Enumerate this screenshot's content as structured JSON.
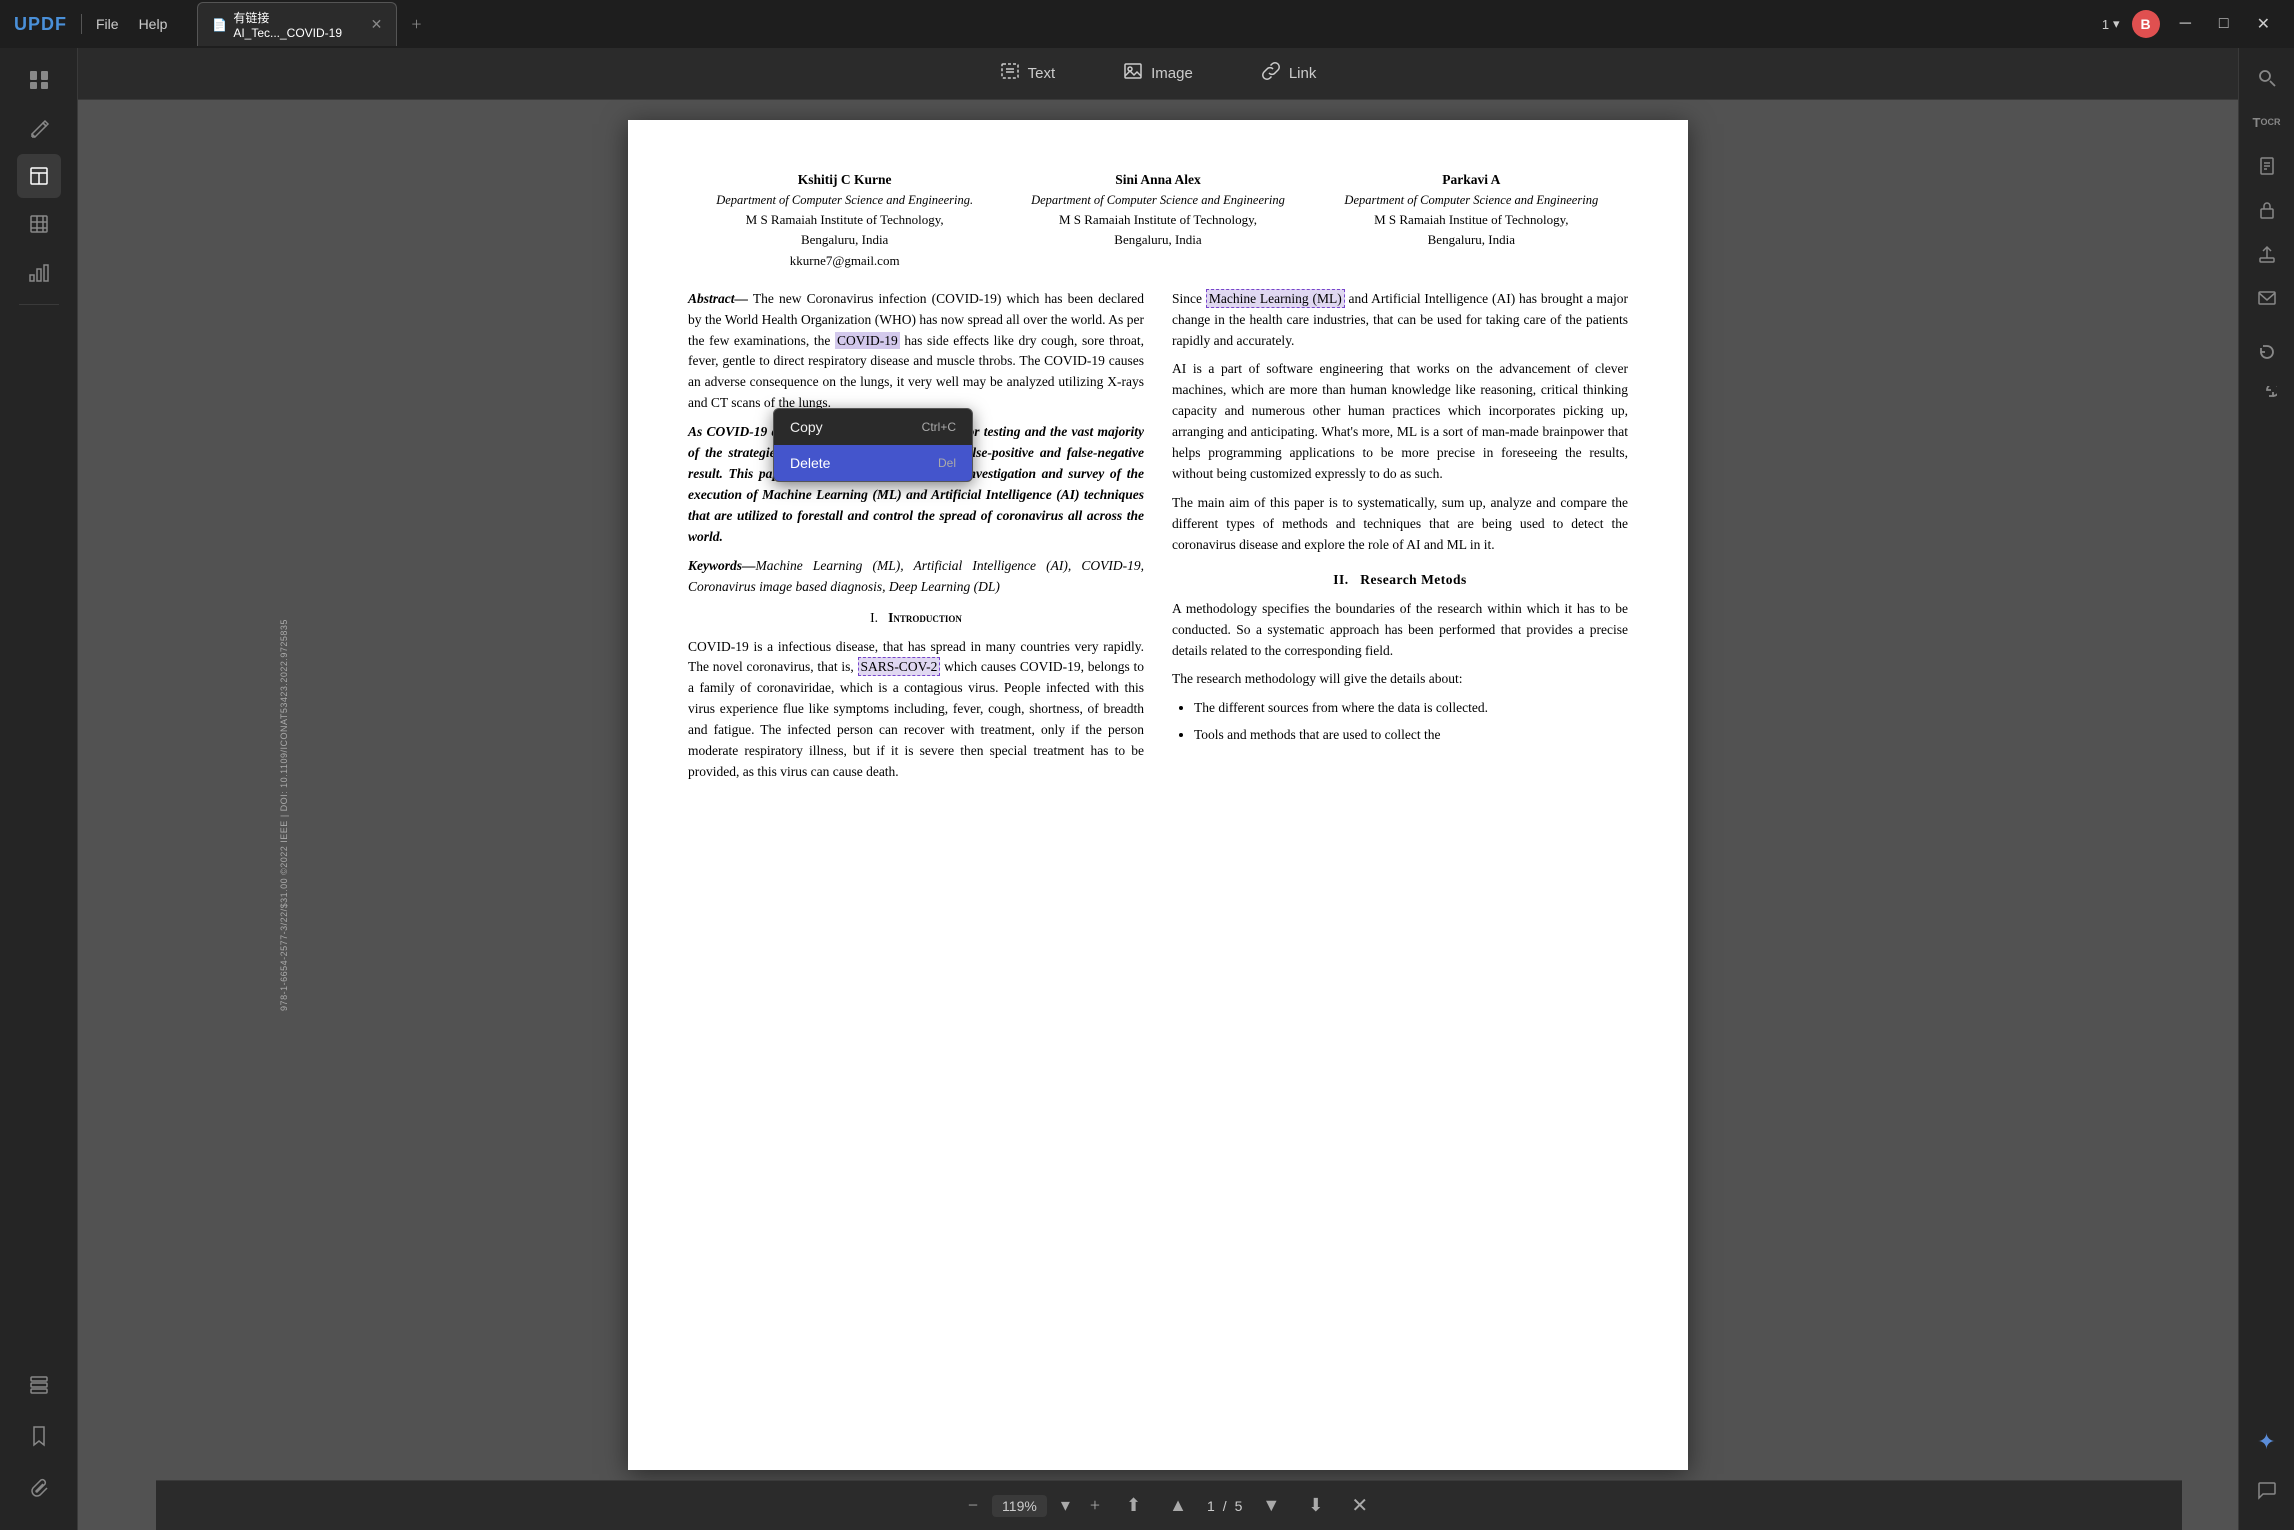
{
  "app": {
    "name": "UPDF",
    "file_menu": "File",
    "help_menu": "Help",
    "tab_title": "有链接AI_Tec..._COVID-19",
    "page_indicator": "1",
    "page_indicator_arrow": "▾"
  },
  "toolbar": {
    "text_label": "Text",
    "image_label": "Image",
    "link_label": "Link"
  },
  "pdf": {
    "author1": {
      "name": "Kshitij C Kurne",
      "dept": "Department of Computer Science and Engineering.",
      "institute": "M S Ramaiah Institute of Technology,",
      "location": "Bengaluru, India",
      "email": "kkurne7@gmail.com"
    },
    "author2": {
      "name": "Sini Anna Alex",
      "dept": "Department of Computer Science and Engineering",
      "institute": "M S Ramaiah Institute of Technology,",
      "location": "Bengaluru, India"
    },
    "author3": {
      "name": "Parkavi A",
      "dept": "Department of Computer Science and Engineering",
      "institute": "M S Ramaiah Institue of Technology,",
      "location": "Bengaluru, India"
    },
    "abstract_label": "Abstract—",
    "abstract_text": " The new Coronavirus infection (COVID-19) which has been declared by the World Health Organization (WHO) has now spread all over the world. As per the few examinations, the COVID-19 has side effects like dry cough, sore throat, fever, gentle to direct respiratory disease and muscle throbs. The COVID-19 causes an adverse consequence on the lungs, it very well may be analyzed utilizing X-rays and CT scans of the lungs.",
    "keywords_label": "Keywords—",
    "keywords_text": "Machine Learning (ML), Artificial Intelligence (AI), COVID-19, Coronavirus image based diagnosis, Deep Learning (DL)",
    "para2_text": "As COVID-19 diagnosing is the lengthy process for testing and the vast majority of the strategies that are proposed might give false-positive and false-negative result. This paper predominantly points on the investigation and survey of the execution of Machine Learning (ML) and Artificial Intelligence (AI) techniques that are utilized to forestall and control the spread of coronavirus all across the world.",
    "intro_numeral": "I.",
    "intro_heading": "Introduction",
    "intro_para1": "COVID-19 is a infectious disease, that has spread in many countries very rapidly. The novel coronavirus, that is, SARS-COV-2 which causes COVID-19, belongs to a family of coronaviridae, which is a contagious virus. People infected with this virus experience flue like symptoms including, fever, cough, shortness, of breadth and fatigue. The infected person can recover with treatment, only if the person moderate respiratory illness, but if it is severe then special treatment has to be provided, as this virus can cause death.",
    "right_para1": "Since Machine Learning (ML) and Artificial Intelligence (AI) has brought a major change in the health care industries, that can be used for taking care of the patients rapidly and accurately.",
    "right_para2": "AI is a part of software engineering that works on the advancement of clever machines, which are more than human knowledge like reasoning, critical thinking capacity and numerous other human practices which incorporates picking up, arranging and anticipating. What's more, ML is a sort of man-made brainpower that helps programming applications to be more precise in foreseeing the results, without being customized expressly to do as such.",
    "right_para3": "The main aim of this paper is to systematically, sum up, analyze and compare the different types of methods and techniques that are being used to detect the coronavirus disease and explore the role of AI and ML in it.",
    "research_numeral": "II.",
    "research_heading": "Research Metods",
    "research_para1": "A methodology specifies the boundaries of the research within which it has to be conducted. So a systematic approach has been performed that provides a precise details related to the corresponding field.",
    "research_para2": "The research methodology will give the details about:",
    "bullet1": "The different sources from where the data is collected.",
    "bullet2": "Tools and methods that are used to collect the"
  },
  "context_menu": {
    "copy_label": "Copy",
    "copy_shortcut": "Ctrl+C",
    "delete_label": "Delete",
    "delete_shortcut": "Del"
  },
  "bottom_bar": {
    "zoom_value": "119%",
    "page_current": "1",
    "page_total": "5"
  },
  "sidebar": {
    "thumbnail_icon": "☰",
    "edit_icon": "✎",
    "layout_icon": "⊞",
    "table_icon": "▦",
    "chart_icon": "⎍",
    "stack_icon": "⧉",
    "bookmark_icon": "⚑",
    "attach_icon": "📎"
  },
  "right_sidebar": {
    "search_icon": "🔍",
    "ocr_icon": "T",
    "page_icon": "📄",
    "lock_icon": "🔒",
    "share_icon": "⬆",
    "mail_icon": "✉",
    "undo_icon": "↺",
    "redo_icon": "↻",
    "ai_icon": "✦",
    "comment_icon": "💬"
  },
  "vertical_text": "978-1-6654-2577-3/22/$31.00 ©2022 IEEE | DOI: 10.1109/ICONAT53423.2022.9725835"
}
